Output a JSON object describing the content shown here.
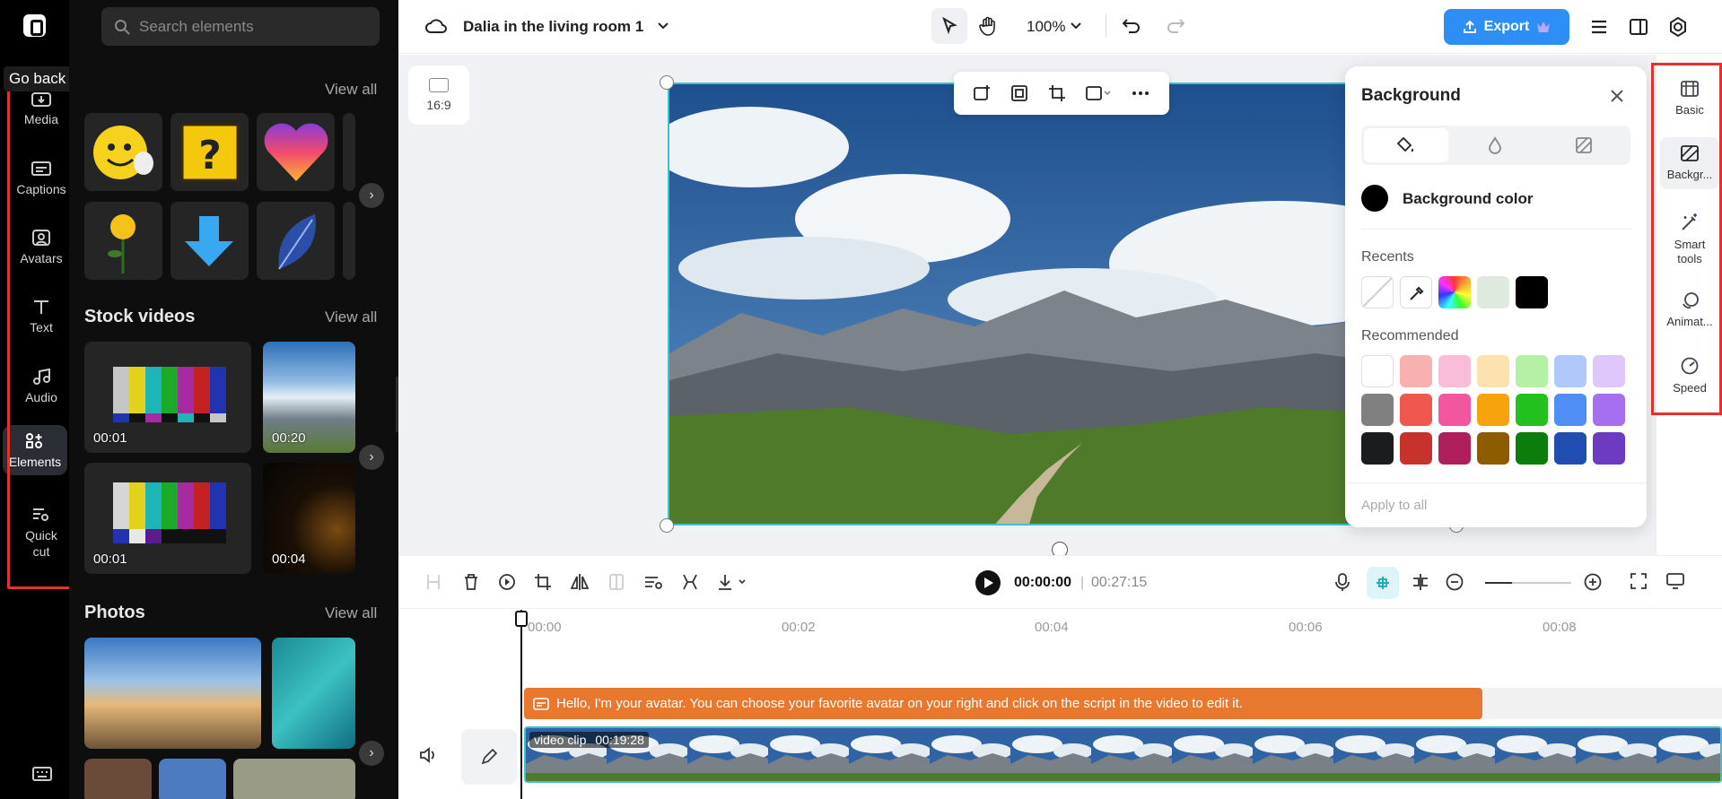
{
  "rail": {
    "tooltip": "Go back to homepage",
    "items": [
      {
        "label": "Media",
        "icon": "media-icon"
      },
      {
        "label": "Captions",
        "icon": "captions-icon"
      },
      {
        "label": "Avatars",
        "icon": "avatars-icon"
      },
      {
        "label": "Text",
        "icon": "text-icon"
      },
      {
        "label": "Audio",
        "icon": "audio-icon"
      },
      {
        "label": "Elements",
        "icon": "elements-icon"
      },
      {
        "label": "Quick cut",
        "icon": "quick-cut-icon"
      }
    ]
  },
  "panel": {
    "search_placeholder": "Search elements",
    "view_all": "View all",
    "stock_videos": {
      "title": "Stock videos",
      "view_all": "View all",
      "durations": [
        "00:01",
        "00:20",
        "00:01",
        "00:04"
      ]
    },
    "photos": {
      "title": "Photos",
      "view_all": "View all"
    }
  },
  "topbar": {
    "project_title": "Dalia in the living room 1",
    "zoom": "100%",
    "export_label": "Export"
  },
  "canvas": {
    "ratio": "16:9"
  },
  "background": {
    "title": "Background",
    "bg_color_label": "Background color",
    "recents_label": "Recents",
    "recommended_label": "Recommended",
    "apply_all": "Apply to all",
    "recent_colors": [
      "#dfeadf",
      "#000000"
    ],
    "recommended": [
      [
        "#ffffff",
        "#f7b1b1",
        "#f9bcd9",
        "#fde2b0",
        "#b4f0a6",
        "#b1c8fb",
        "#dfc7fb"
      ],
      [
        "#808080",
        "#f0574f",
        "#f2569f",
        "#f6a30c",
        "#23c11e",
        "#4f8ff5",
        "#a66ef0"
      ],
      [
        "#1b1c20",
        "#c7332c",
        "#b11f5a",
        "#8e5c00",
        "#0b7d0b",
        "#1f4db0",
        "#6d3bc1"
      ]
    ]
  },
  "right_rail": {
    "items": [
      {
        "label": "Basic",
        "icon": "basic-icon"
      },
      {
        "label": "Backgr...",
        "icon": "background-icon"
      },
      {
        "label": "Smart tools",
        "icon": "smart-tools-icon"
      },
      {
        "label": "Animat...",
        "icon": "animation-icon"
      },
      {
        "label": "Speed",
        "icon": "speed-icon"
      }
    ]
  },
  "playback": {
    "current": "00:00:00",
    "separator": "|",
    "total": "00:27:15"
  },
  "timeline": {
    "ticks": [
      "00:00",
      "00:02",
      "00:04",
      "00:06",
      "00:08"
    ],
    "caption": "Hello, I'm your avatar. You can choose your favorite avatar on your right and click on the script in the video to edit it.",
    "clip_label": "video clip",
    "clip_duration": "00:19:28"
  },
  "colors": {
    "accent": "#2d8ff5",
    "selection": "#3ec1c9",
    "caption": "#e8782e",
    "highlight": "#e4322b"
  }
}
